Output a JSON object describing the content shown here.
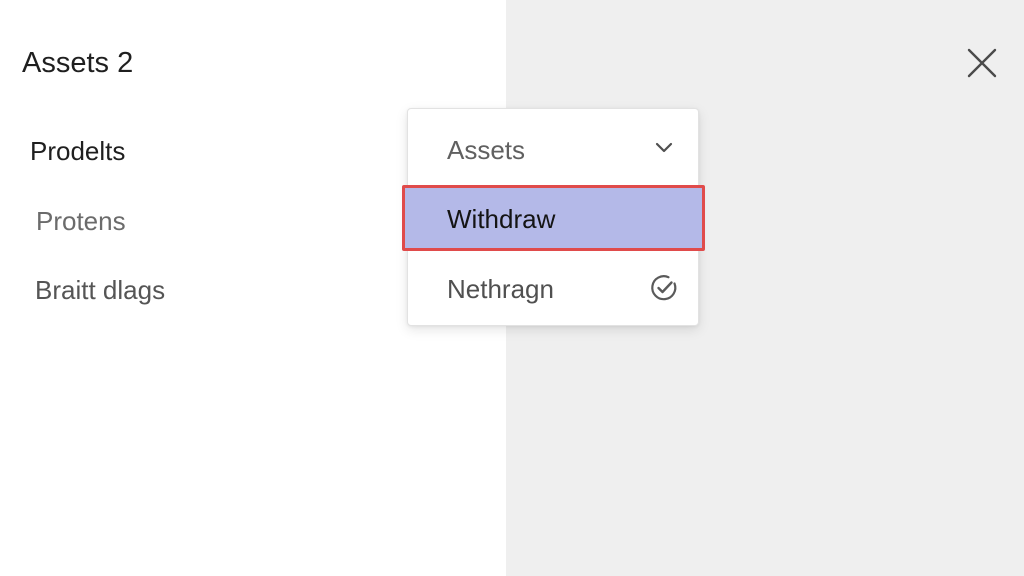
{
  "panel": {
    "title": "Assets 2"
  },
  "nav": {
    "items": [
      {
        "label": "Prodelts"
      },
      {
        "label": "Protens"
      },
      {
        "label": "Braitt dlags"
      }
    ]
  },
  "dropdown": {
    "selected_label": "Assets",
    "options": [
      {
        "label": "Withdraw",
        "highlighted": true
      },
      {
        "label": "Nethragn",
        "icon": "check-circle-icon"
      }
    ]
  },
  "colors": {
    "highlight_fill": "#b4b9e8",
    "highlight_border": "#e04b4b",
    "right_pane_bg": "#efefef"
  },
  "icons": {
    "close": "close-icon",
    "chevron": "chevron-down-icon",
    "check": "check-circle-icon"
  }
}
